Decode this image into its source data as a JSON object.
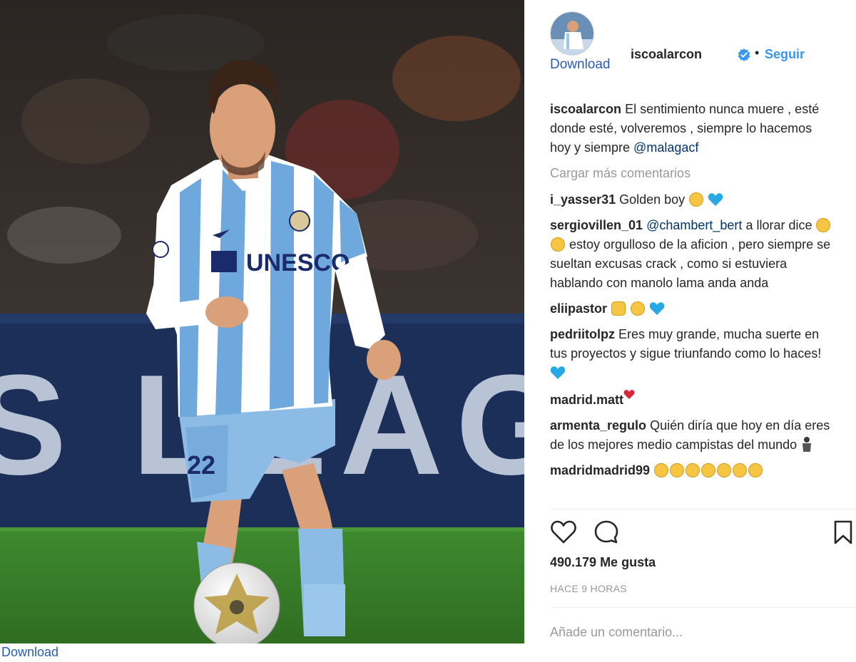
{
  "post": {
    "downloads": {
      "top": "Download",
      "bottom": "Download"
    },
    "author": {
      "username": "iscoalarcon",
      "follow": "Seguir",
      "separator": "•"
    },
    "caption": {
      "user": "iscoalarcon",
      "text": "El sentimiento nunca muere , esté donde esté, volveremos , siempre lo hacemos hoy y siempre ",
      "mention": "@malagacf"
    },
    "load_more": "Cargar más comentarios",
    "comments": [
      {
        "user": "i_yasser31",
        "text": "Golden boy "
      },
      {
        "user": "sergiovillen_01",
        "mention": "@chambert_bert",
        "text": " a llorar dice ",
        "text2": " estoy orgulloso de la aficion , pero siempre se sueltan excusas crack , como si estuviera hablando con manolo lama anda anda"
      },
      {
        "user": "eliipastor",
        "text": ""
      },
      {
        "user": "pedriitolpz",
        "text": "Eres muy grande, mucha suerte en tus proyectos y sigue triunfando como lo haces! "
      },
      {
        "user": "madrid.matt",
        "text": ""
      },
      {
        "user": "armenta_regulo",
        "text": "Quién diría que hoy en día eres de los mejores medio campistas del mundo "
      },
      {
        "user": "madridmadrid99",
        "text": ""
      }
    ],
    "likes": "490.179 Me gusta",
    "time": "HACE 9 HORAS",
    "add_comment_placeholder": "Añade un comentario...",
    "photo": {
      "sponsor": "UNESCO",
      "banner_text": "S LEAGUE",
      "number": "22"
    },
    "colors": {
      "link": "#3897f0",
      "download": "#2a5db0",
      "muted": "#999999"
    },
    "icons": [
      "heart-icon",
      "comment-icon",
      "bookmark-icon",
      "verified-badge-icon"
    ]
  }
}
